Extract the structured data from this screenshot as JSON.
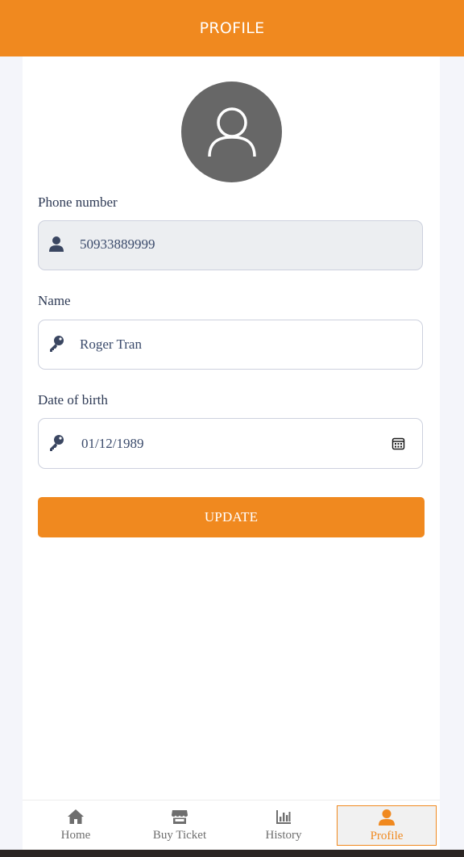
{
  "header": {
    "title": "PROFILE"
  },
  "form": {
    "phone": {
      "label": "Phone number",
      "value": "50933889999",
      "icon": "user-icon",
      "disabled": true
    },
    "name": {
      "label": "Name",
      "value": "Roger Tran",
      "icon": "key-icon"
    },
    "dob": {
      "label": "Date of birth",
      "value": "01/12/1989",
      "icon": "key-icon",
      "picker_icon": "calendar-icon"
    },
    "submit_label": "UPDATE"
  },
  "nav": {
    "items": [
      {
        "label": "Home",
        "icon": "home-icon"
      },
      {
        "label": "Buy Ticket",
        "icon": "store-icon"
      },
      {
        "label": "History",
        "icon": "bar-chart-icon"
      },
      {
        "label": "Profile",
        "icon": "user-icon",
        "active": true
      }
    ]
  },
  "colors": {
    "accent": "#f0891f",
    "avatar_bg": "#676767",
    "text": "#2e3a55"
  }
}
